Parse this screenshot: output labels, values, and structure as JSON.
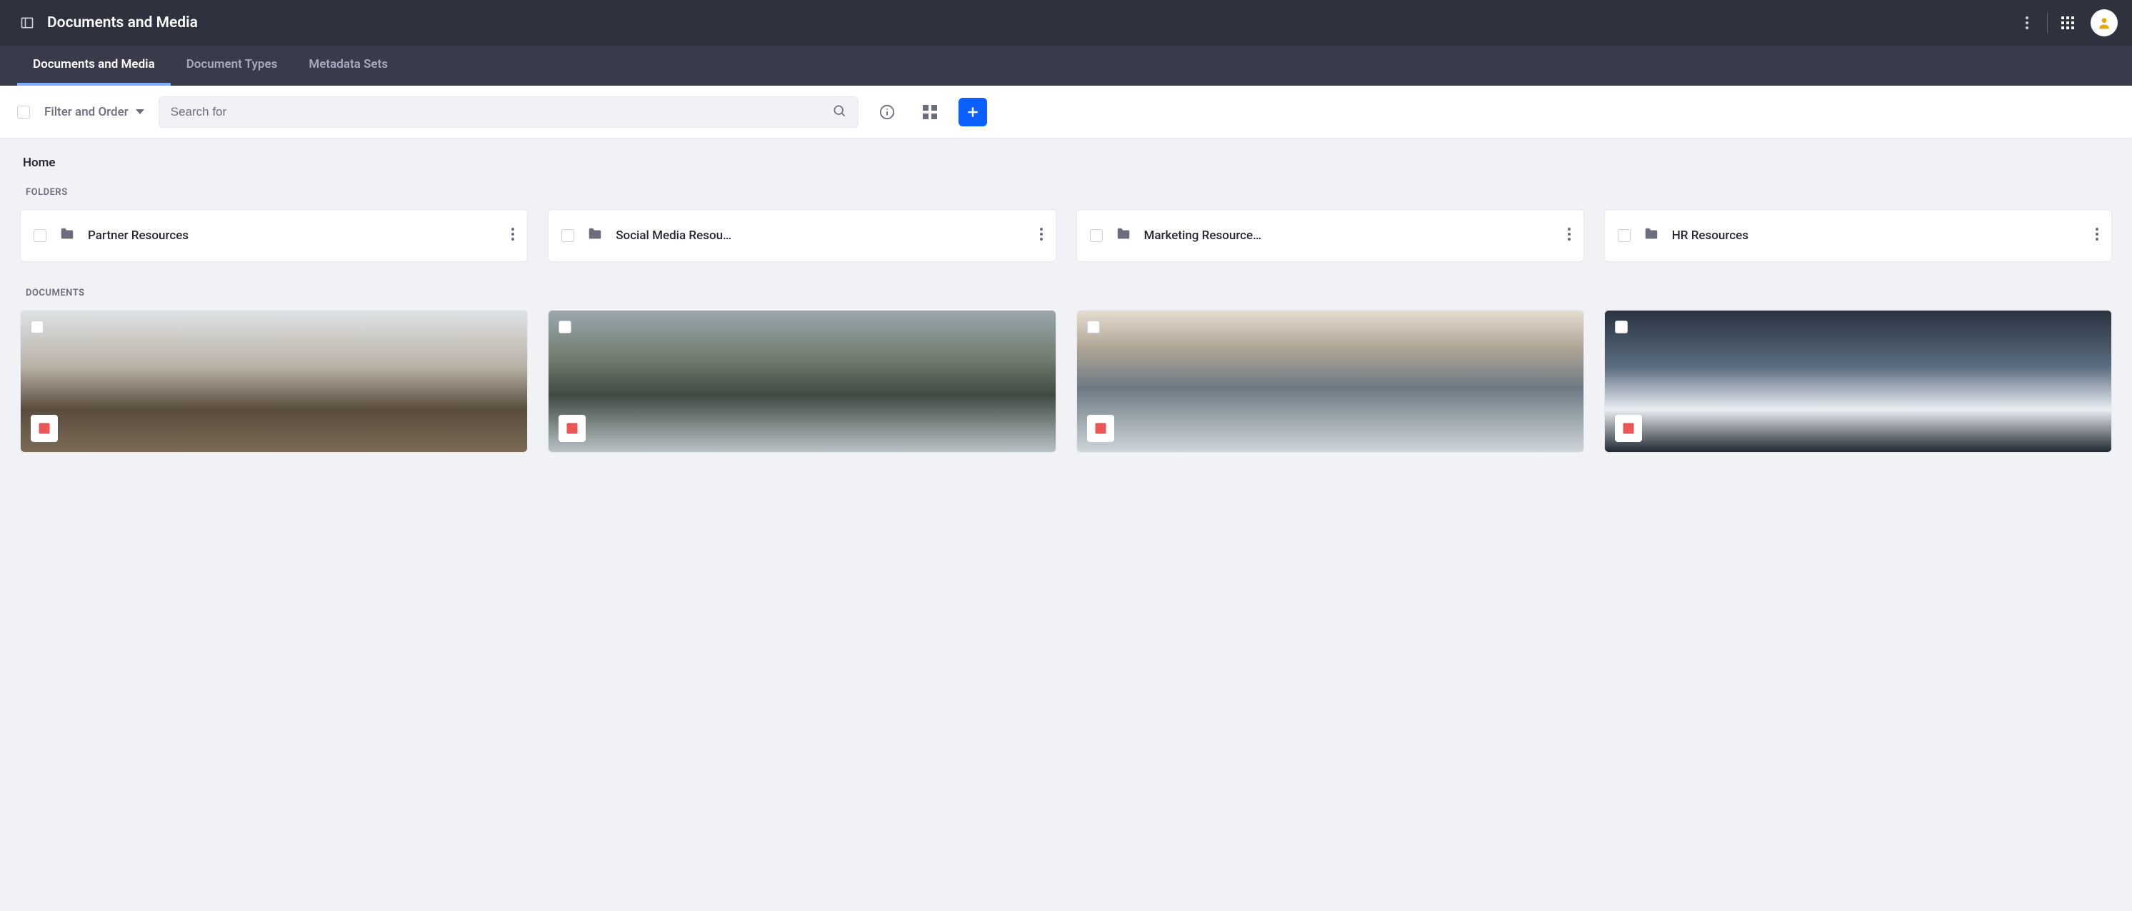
{
  "header": {
    "title": "Documents and Media"
  },
  "tabs": [
    {
      "label": "Documents and Media",
      "active": true
    },
    {
      "label": "Document Types",
      "active": false
    },
    {
      "label": "Metadata Sets",
      "active": false
    }
  ],
  "toolbar": {
    "filter_label": "Filter and Order",
    "search_placeholder": "Search for"
  },
  "breadcrumb": "Home",
  "sections": {
    "folders_label": "FOLDERS",
    "documents_label": "DOCUMENTS"
  },
  "folders": [
    {
      "name": "Partner Resources"
    },
    {
      "name": "Social Media Resou…"
    },
    {
      "name": "Marketing Resource…"
    },
    {
      "name": "HR Resources"
    }
  ],
  "documents": [
    {
      "thumb_class": "thumb1"
    },
    {
      "thumb_class": "thumb2"
    },
    {
      "thumb_class": "thumb3"
    },
    {
      "thumb_class": "thumb4"
    }
  ]
}
